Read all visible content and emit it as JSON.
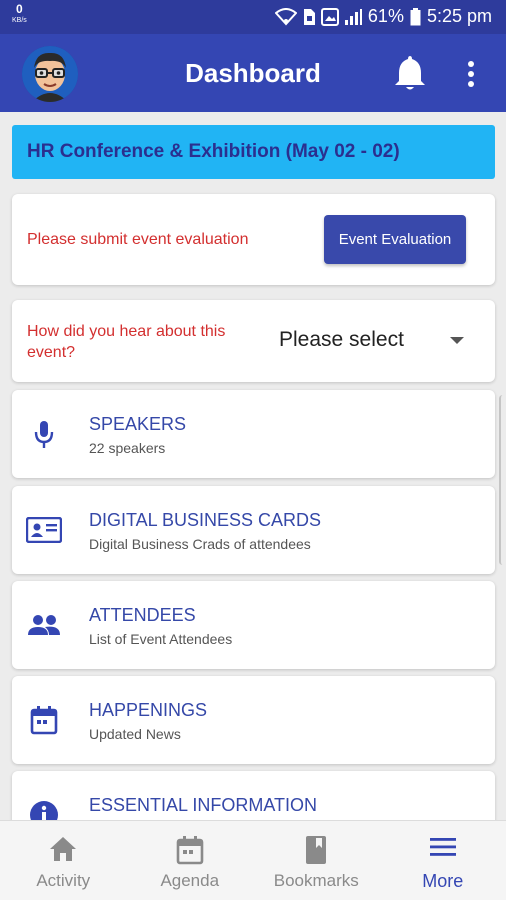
{
  "status_bar": {
    "speed_value": "0",
    "speed_unit": "KB/s",
    "battery": "61%",
    "time": "5:25 pm"
  },
  "app_bar": {
    "title": "Dashboard",
    "icons": [
      "avatar",
      "bell-icon",
      "more-vert-icon"
    ]
  },
  "event": {
    "title": "HR Conference & Exhibition (May 02 - 02)"
  },
  "evaluation": {
    "prompt": "Please submit event evaluation",
    "button_label": "Event Evaluation"
  },
  "hear_about": {
    "question": "How did you hear about this event?",
    "selected": "Please select"
  },
  "menu_items": [
    {
      "title": "SPEAKERS",
      "subtitle": "22 speakers",
      "icon": "microphone-icon"
    },
    {
      "title": "DIGITAL BUSINESS CARDS",
      "subtitle": "Digital Business Crads of attendees",
      "icon": "business-card-icon"
    },
    {
      "title": "ATTENDEES",
      "subtitle": "List of Event Attendees",
      "icon": "people-icon"
    },
    {
      "title": "HAPPENINGS",
      "subtitle": "Updated News",
      "icon": "calendar-icon"
    },
    {
      "title": "ESSENTIAL INFORMATION",
      "subtitle": "",
      "icon": "info-icon"
    }
  ],
  "bottom_nav": {
    "items": [
      {
        "label": "Activity",
        "icon": "home-icon"
      },
      {
        "label": "Agenda",
        "icon": "calendar-icon"
      },
      {
        "label": "Bookmarks",
        "icon": "bookmark-icon"
      },
      {
        "label": "More",
        "icon": "menu-icon",
        "active": true
      }
    ]
  },
  "colors": {
    "status_bar": "#2e3b9c",
    "app_bar": "#3446b3",
    "banner": "#21b4f4",
    "accent": "#3949ab",
    "alert_text": "#d32f2f"
  }
}
